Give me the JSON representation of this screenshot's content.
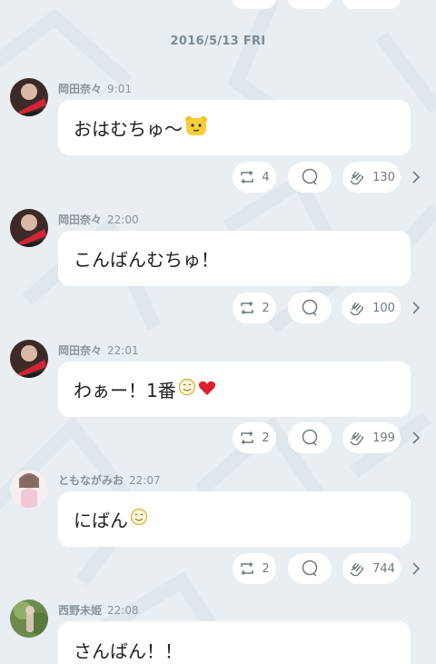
{
  "date_header": "2016/5/13 FRI",
  "messages": [
    {
      "name": "岡田奈々",
      "time": "9:01",
      "text": "おはむちゅ〜",
      "emoji": "bear-emoji",
      "retweets": "4",
      "claps": "130"
    },
    {
      "name": "岡田奈々",
      "time": "22:00",
      "text": "こんばんむちゅ！",
      "retweets": "2",
      "claps": "100"
    },
    {
      "name": "岡田奈々",
      "time": "22:01",
      "text": "わぁー！1番",
      "emoji": "smile-heart-emoji",
      "retweets": "2",
      "claps": "199"
    },
    {
      "name": "ともながみお",
      "time": "22:07",
      "text": "にばん",
      "emoji": "smile-emoji",
      "retweets": "2",
      "claps": "744"
    },
    {
      "name": "西野未姫",
      "time": "22:08",
      "text": "さんばん！！"
    }
  ],
  "colors": {
    "background": "#e9eef2",
    "bubble": "#ffffff",
    "meta_text": "#8a949b",
    "icon": "#6f7a82",
    "emoji_yellow": "#f7cf3a",
    "heart": "#e0202a"
  }
}
